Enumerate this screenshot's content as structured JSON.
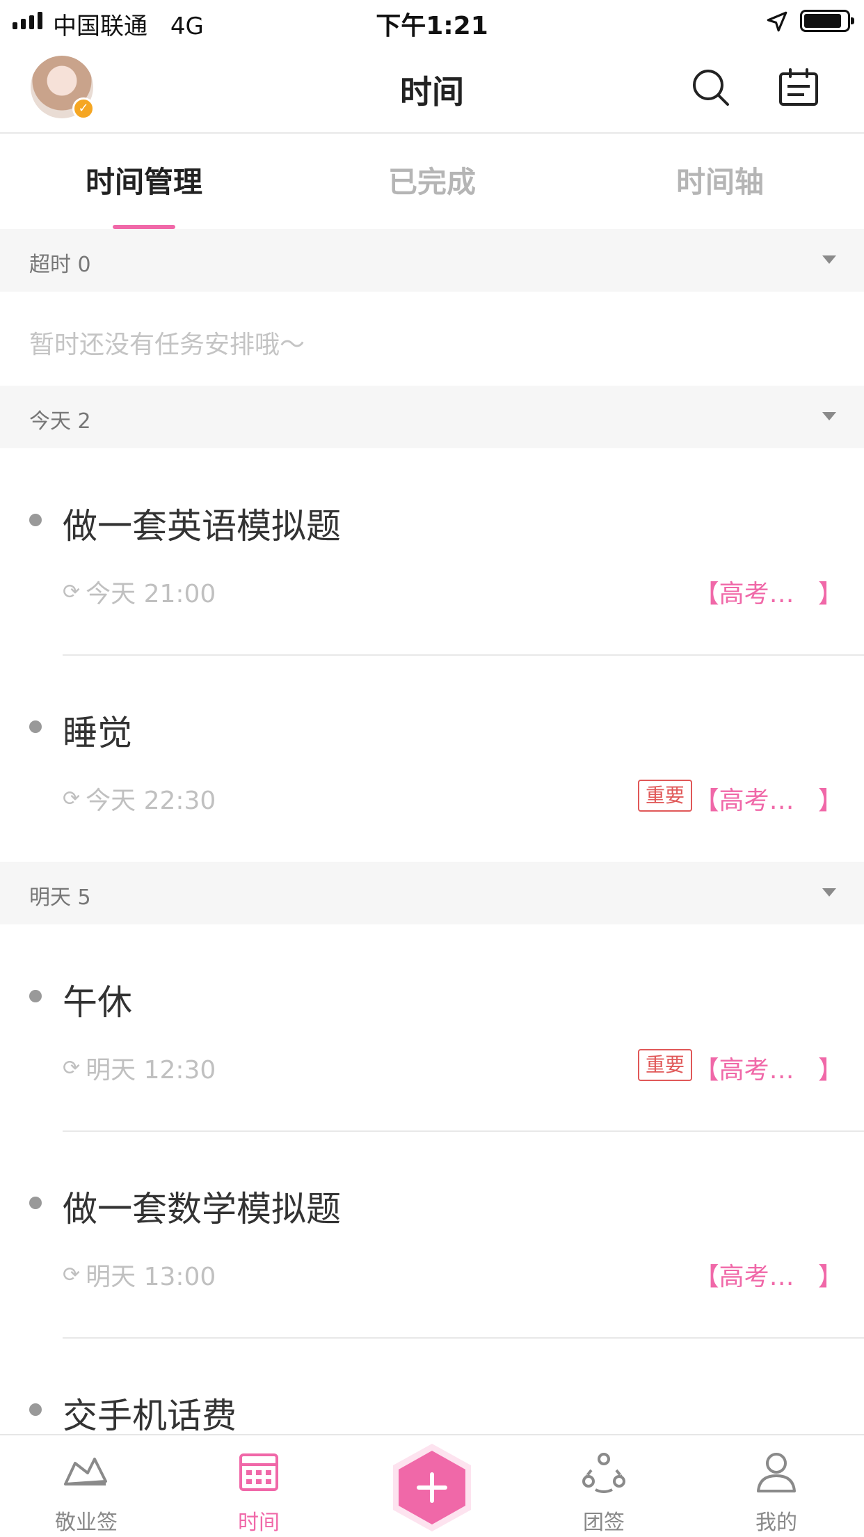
{
  "status_bar": {
    "carrier": "中国联通",
    "network": "4G",
    "time": "下午1:21"
  },
  "header": {
    "title": "时间"
  },
  "tabs": [
    {
      "label": "时间管理",
      "active": true
    },
    {
      "label": "已完成",
      "active": false
    },
    {
      "label": "时间轴",
      "active": false
    }
  ],
  "sections": {
    "overdue": {
      "label": "超时",
      "count": "0",
      "empty_text": "暂时还没有任务安排哦～"
    },
    "today": {
      "label": "今天",
      "count": "2"
    },
    "tomorrow": {
      "label": "明天",
      "count": "5"
    }
  },
  "tasks": [
    {
      "title": "做一套英语模拟题",
      "time": "今天 21:00",
      "important": "",
      "list_tag": "【高考…   】"
    },
    {
      "title": "睡觉",
      "time": "今天 22:30",
      "important": "重要",
      "list_tag": "【高考…   】"
    },
    {
      "title": "午休",
      "time": "明天 12:30",
      "important": "重要",
      "list_tag": "【高考…   】"
    },
    {
      "title": "做一套数学模拟题",
      "time": "明天 13:00",
      "important": "",
      "list_tag": "【高考…   】"
    },
    {
      "title": "交手机话费"
    }
  ],
  "tab_bar": [
    {
      "label": "敬业签",
      "icon": "note-icon"
    },
    {
      "label": "时间",
      "icon": "calendar-icon",
      "active": true
    },
    {
      "label": "",
      "icon": "add-icon"
    },
    {
      "label": "团签",
      "icon": "team-icon"
    },
    {
      "label": "我的",
      "icon": "profile-icon"
    }
  ],
  "colors": {
    "accent": "#f068a8",
    "important": "#e05858",
    "muted": "#c0c0c0",
    "section_bg": "#f6f6f6"
  }
}
